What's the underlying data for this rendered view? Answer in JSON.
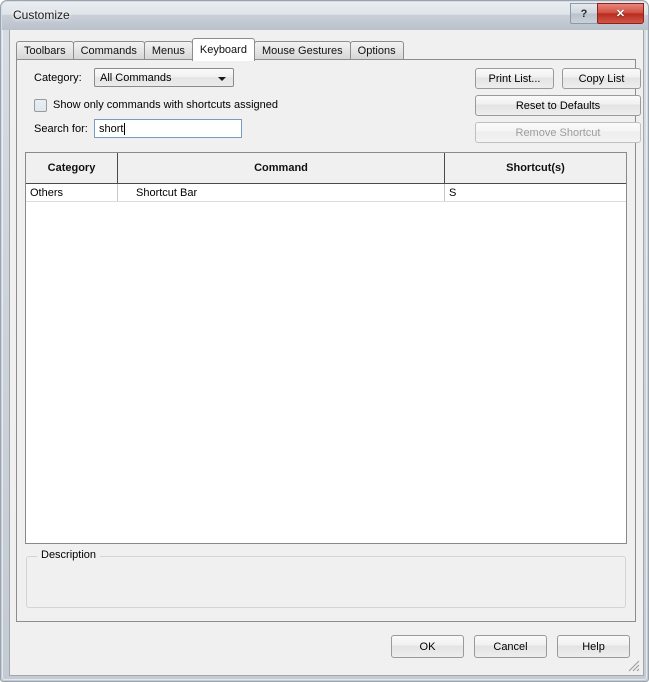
{
  "window": {
    "title": "Customize",
    "help_button": "?",
    "close_button": "✕"
  },
  "tabs": [
    {
      "label": "Toolbars",
      "selected": false
    },
    {
      "label": "Commands",
      "selected": false
    },
    {
      "label": "Menus",
      "selected": false
    },
    {
      "label": "Keyboard",
      "selected": true
    },
    {
      "label": "Mouse Gestures",
      "selected": false
    },
    {
      "label": "Options",
      "selected": false
    }
  ],
  "keyboard_page": {
    "category_label": "Category:",
    "category_value": "All Commands",
    "show_only_label": "Show only commands with shortcuts assigned",
    "show_only_checked": false,
    "search_label": "Search for:",
    "search_value": "short",
    "search_placeholder": "",
    "buttons": {
      "print_list": "Print List...",
      "copy_list": "Copy List",
      "reset_defaults": "Reset to Defaults",
      "remove_shortcut": "Remove Shortcut",
      "remove_shortcut_enabled": false
    },
    "table": {
      "columns": [
        "Category",
        "Command",
        "Shortcut(s)"
      ],
      "rows": [
        {
          "category": "Others",
          "command": "Shortcut Bar",
          "shortcut": "S"
        }
      ]
    },
    "description": {
      "legend": "Description",
      "text": ""
    }
  },
  "footer": {
    "ok": "OK",
    "cancel": "Cancel",
    "help": "Help"
  },
  "colors": {
    "close_red": "#b62a1c",
    "accent_blue": "#7a9bc0",
    "dialog_face": "#f0f0f0"
  }
}
